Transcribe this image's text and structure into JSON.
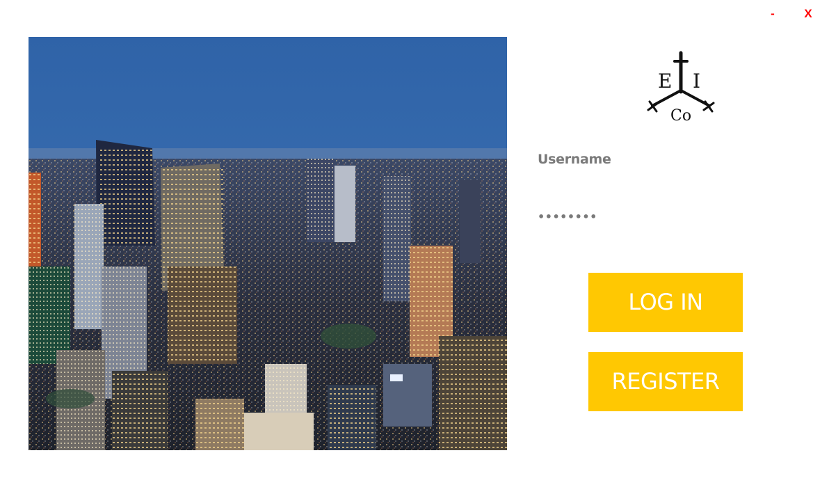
{
  "window": {
    "minimize_label": "-",
    "close_label": "X"
  },
  "logo": {
    "letters_left": "E",
    "letters_right": "I",
    "letters_bottom": "Co",
    "icon": "east-india-company-logo"
  },
  "form": {
    "username_placeholder": "Username",
    "password_value": "••••••••"
  },
  "buttons": {
    "login_label": "LOG IN",
    "register_label": "REGISTER"
  },
  "colors": {
    "accent": "#ffc802",
    "window_controls": "#ff0000",
    "label_gray": "#7a7a7a"
  }
}
